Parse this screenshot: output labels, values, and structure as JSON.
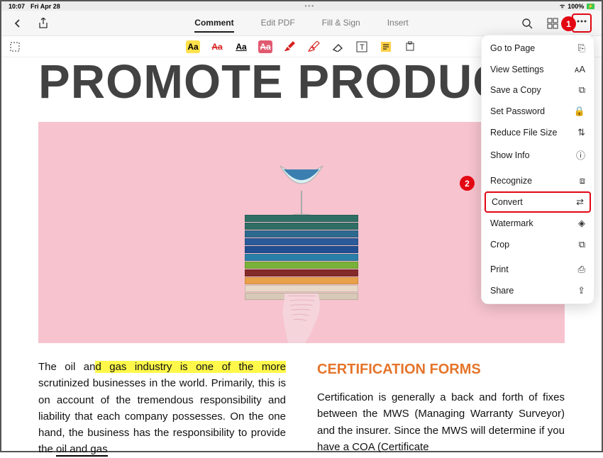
{
  "status": {
    "time": "10:07",
    "date": "Fri Apr 28",
    "battery": "100%"
  },
  "toolbar": {
    "tabs": [
      "Comment",
      "Edit PDF",
      "Fill & Sign",
      "Insert"
    ],
    "active_tab": 0
  },
  "dropdown": {
    "groups": [
      [
        "Go to Page",
        "View Settings",
        "Save a Copy",
        "Set Password",
        "Reduce File Size",
        "Show Info"
      ],
      [
        "Recognize",
        "Convert",
        "Watermark",
        "Crop"
      ],
      [
        "Print",
        "Share"
      ]
    ],
    "icons": {
      "Go to Page": "⎘",
      "View Settings": "ᴀA",
      "Save a Copy": "⧉",
      "Set Password": "🔒",
      "Reduce File Size": "⇅",
      "Show Info": "ⓘ",
      "Recognize": "⧈",
      "Convert": "⇄",
      "Watermark": "◈",
      "Crop": "⧉",
      "Print": "⎙",
      "Share": "⇪"
    }
  },
  "callouts": {
    "one": "1",
    "two": "2"
  },
  "document": {
    "title": "PROMOTE PRODUCTIV",
    "col1": {
      "pre": "The oil an",
      "hl1": "d gas industry is ",
      "mid": "",
      "hl2": "one of the more",
      "rest": " scrutinized businesses in the world. Primarily, this is on account of the tremendous responsibility and liability that each company possesses. On the one hand, the business has the responsibility to provide the ",
      "ul": "oil and gas"
    },
    "col2": {
      "heading": "CERTIFICATION FORMS",
      "body": "Certification is generally a back and forth of fixes between the MWS (Managing Warranty Surveyor) and the insurer. Since the MWS will determine if you have a COA (Certificate"
    }
  },
  "hero_books": [
    "#2f6e65",
    "#2f6e65",
    "#2d6a8f",
    "#2a5a99",
    "#204f91",
    "#2a7fa8",
    "#79b13a",
    "#842a2a",
    "#e8a04a",
    "#e8d8c8",
    "#d9c9b8"
  ]
}
